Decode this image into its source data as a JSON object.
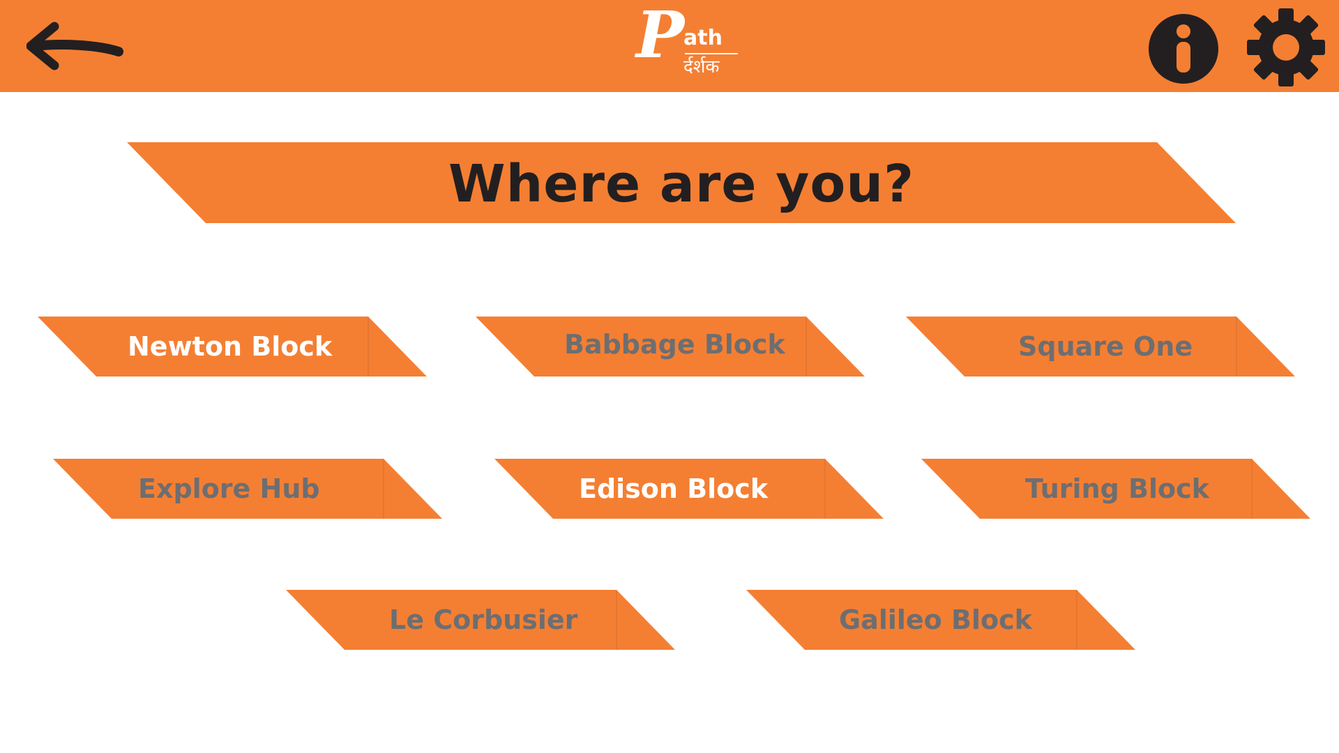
{
  "header": {
    "back_icon": "back-arrow-icon",
    "logo": {
      "main": "P",
      "suffix": "ath",
      "subtitle": "र्दर्शक"
    },
    "info_icon": "info-icon",
    "settings_icon": "gear-icon"
  },
  "title": "Where are you?",
  "locations": [
    {
      "label": "Newton Block",
      "state": "active"
    },
    {
      "label": "Babbage Block",
      "state": "inactive"
    },
    {
      "label": "Square One",
      "state": "inactive"
    },
    {
      "label": "Explore Hub",
      "state": "inactive"
    },
    {
      "label": "Edison Block",
      "state": "active"
    },
    {
      "label": "Turing Block",
      "state": "inactive"
    },
    {
      "label": "Le Corbusier",
      "state": "inactive"
    },
    {
      "label": "Galileo Block",
      "state": "inactive"
    }
  ],
  "colors": {
    "accent": "#f47f33",
    "title_text": "#231f20",
    "label_active": "#ffffff",
    "label_inactive": "#6d6e71",
    "background": "#ffffff"
  }
}
